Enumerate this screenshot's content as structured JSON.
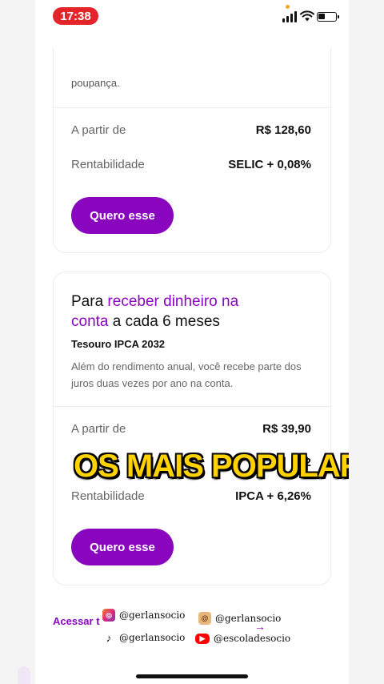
{
  "status_bar": {
    "time": "17:38"
  },
  "card1": {
    "desc_tail": "poupança.",
    "rows": [
      {
        "label": "A partir de",
        "value": "R$ 128,60"
      },
      {
        "label": "Rentabilidade",
        "value": "SELIC + 0,08%"
      }
    ],
    "button": "Quero esse"
  },
  "card2": {
    "title_pre": "Para ",
    "title_hl": "receber dinheiro na conta",
    "title_post": " a cada 6 meses",
    "subtitle": "Tesouro IPCA 2032",
    "desc": "Além do rendimento anual, você recebe parte dos juros duas vezes por ano na conta.",
    "rows": [
      {
        "label": "A partir de",
        "value": "R$ 39,90"
      },
      {
        "label": "",
        "value": "32"
      },
      {
        "label": "Rentabilidade",
        "value": "IPCA + 6,26%"
      }
    ],
    "button": "Quero esse"
  },
  "overlay_text": "OS MAIS POPULARES",
  "footer": {
    "access_link": "Acessar t"
  },
  "socials": {
    "instagram": "@gerlansocio",
    "threads": "@gerlansocio",
    "tiktok": "@gerlansocio",
    "youtube": "@escoladesocio"
  },
  "colors": {
    "accent": "#8a05be",
    "overlay": "#ffd200",
    "time_pill": "#e3242b"
  },
  "icons": [
    "back-chevron-icon",
    "signal-icon",
    "wifi-icon",
    "battery-icon",
    "instagram-icon",
    "threads-icon",
    "tiktok-icon",
    "youtube-icon",
    "arrow-right-icon"
  ]
}
